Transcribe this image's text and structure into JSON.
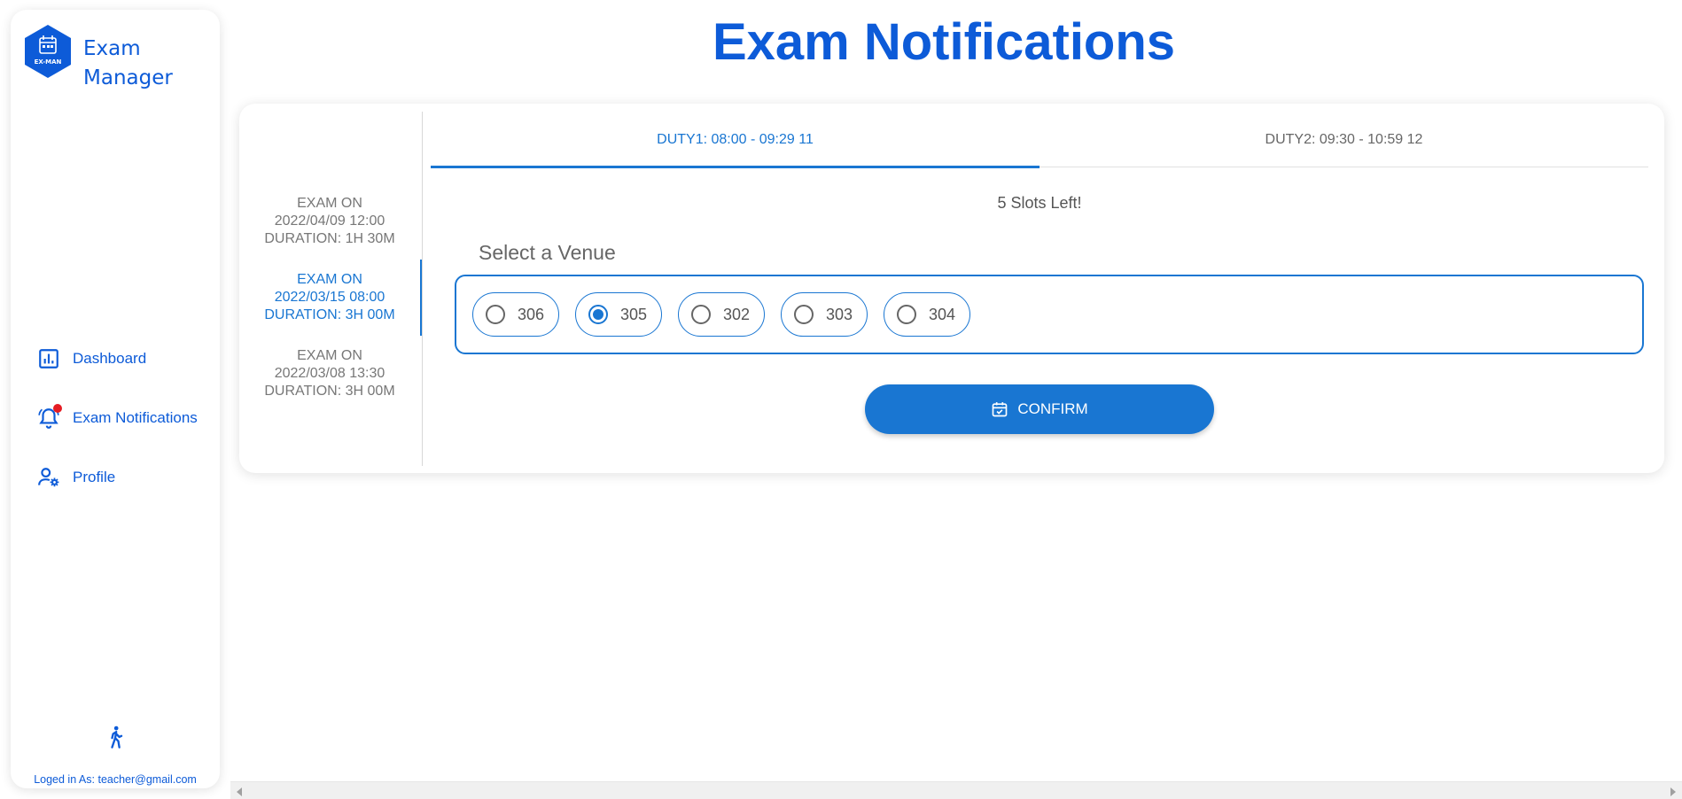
{
  "sidebar": {
    "logo_text": "EX-MAN",
    "app_name": "Exam Manager",
    "items": [
      {
        "label": "Dashboard",
        "icon": "bar-chart-icon"
      },
      {
        "label": "Exam Notifications",
        "icon": "bell-icon"
      },
      {
        "label": "Profile",
        "icon": "user-settings-icon"
      }
    ],
    "logged_in_text": "Loged in As: teacher@gmail.com"
  },
  "page": {
    "title": "Exam Notifications"
  },
  "exams": [
    {
      "line1": "EXAM ON",
      "line2": "2022/04/09 12:00",
      "line3": "DURATION: 1H 30M",
      "active": false
    },
    {
      "line1": "EXAM ON",
      "line2": "2022/03/15 08:00",
      "line3": "DURATION: 3H 00M",
      "active": true
    },
    {
      "line1": "EXAM ON",
      "line2": "2022/03/08 13:30",
      "line3": "DURATION: 3H 00M",
      "active": false
    }
  ],
  "tabs": [
    {
      "label": "DUTY1: 08:00 - 09:29 11",
      "active": true
    },
    {
      "label": "DUTY2: 09:30 - 10:59 12",
      "active": false
    }
  ],
  "slots_text": "5 Slots Left!",
  "venue": {
    "label": "Select a Venue",
    "options": [
      "306",
      "305",
      "302",
      "303",
      "304"
    ],
    "selected": "305"
  },
  "confirm_label": "CONFIRM",
  "colors": {
    "accent": "#1976d2",
    "title": "#0d5bd8",
    "badge": "#e51c23"
  }
}
